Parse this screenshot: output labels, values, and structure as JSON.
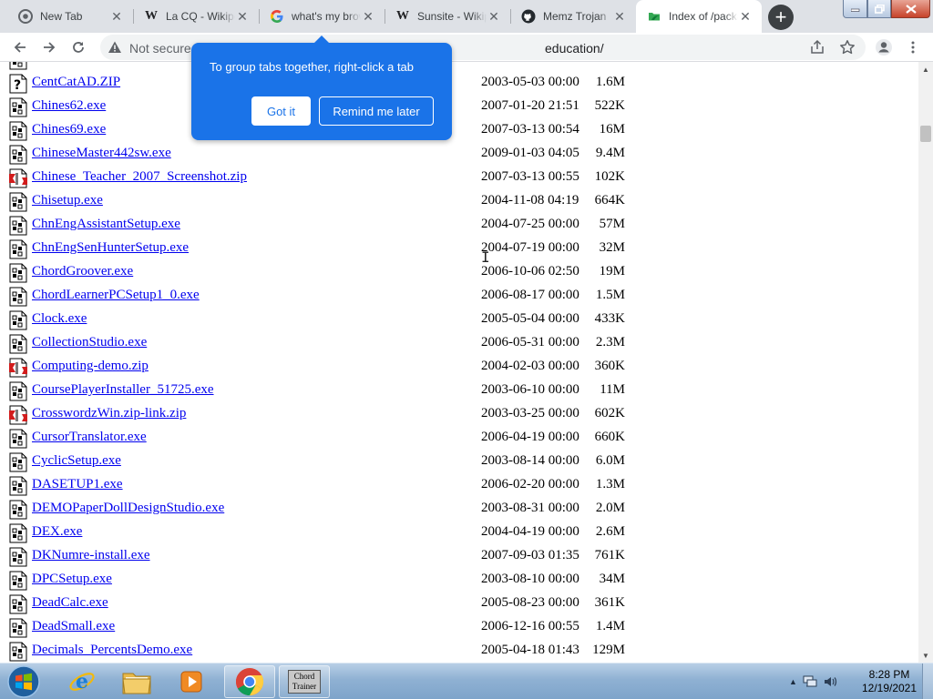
{
  "browser": {
    "tabs": [
      {
        "title": "New Tab",
        "icon": "chrome-icon",
        "active": false
      },
      {
        "title": "La CQ - Wikipedia",
        "icon": "wikipedia-icon",
        "active": false
      },
      {
        "title": "what's my browser",
        "icon": "google-icon",
        "active": false
      },
      {
        "title": "Sunsite - Wikipedia",
        "icon": "wikipedia-icon",
        "active": false
      },
      {
        "title": "Memz Trojan",
        "icon": "github-icon",
        "active": false
      },
      {
        "title": "Index of /packages/education/",
        "icon": "folder-leaf-icon",
        "active": true
      }
    ],
    "new_tab_label": "+",
    "address_bar": {
      "security_label": "Not secure",
      "url_visible_tail": "education/"
    }
  },
  "tab_group_bubble": {
    "message": "To group tabs together, right-click a tab",
    "got_it_label": "Got it",
    "remind_label": "Remind me later"
  },
  "listing": [
    {
      "name": "",
      "date": "",
      "size": "",
      "type": "exe"
    },
    {
      "name": "CentCatAD.ZIP",
      "date": "2003-05-03 00:00",
      "size": "1.6M",
      "type": "unknown"
    },
    {
      "name": "Chines62.exe",
      "date": "2007-01-20 21:51",
      "size": "522K",
      "type": "exe"
    },
    {
      "name": "Chines69.exe",
      "date": "2007-03-13 00:54",
      "size": "16M",
      "type": "exe"
    },
    {
      "name": "ChineseMaster442sw.exe",
      "date": "2009-01-03 04:05",
      "size": "9.4M",
      "type": "exe"
    },
    {
      "name": "Chinese_Teacher_2007_Screenshot.zip",
      "date": "2007-03-13 00:55",
      "size": "102K",
      "type": "zip"
    },
    {
      "name": "Chisetup.exe",
      "date": "2004-11-08 04:19",
      "size": "664K",
      "type": "exe"
    },
    {
      "name": "ChnEngAssistantSetup.exe",
      "date": "2004-07-25 00:00",
      "size": "57M",
      "type": "exe"
    },
    {
      "name": "ChnEngSenHunterSetup.exe",
      "date": "2004-07-19 00:00",
      "size": "32M",
      "type": "exe"
    },
    {
      "name": "ChordGroover.exe",
      "date": "2006-10-06 02:50",
      "size": "19M",
      "type": "exe"
    },
    {
      "name": "ChordLearnerPCSetup1_0.exe",
      "date": "2006-08-17 00:00",
      "size": "1.5M",
      "type": "exe"
    },
    {
      "name": "Clock.exe",
      "date": "2005-05-04 00:00",
      "size": "433K",
      "type": "exe"
    },
    {
      "name": "CollectionStudio.exe",
      "date": "2006-05-31 00:00",
      "size": "2.3M",
      "type": "exe"
    },
    {
      "name": "Computing-demo.zip",
      "date": "2004-02-03 00:00",
      "size": "360K",
      "type": "zip"
    },
    {
      "name": "CoursePlayerInstaller_51725.exe",
      "date": "2003-06-10 00:00",
      "size": "11M",
      "type": "exe"
    },
    {
      "name": "CrosswordzWin.zip-link.zip",
      "date": "2003-03-25 00:00",
      "size": "602K",
      "type": "zip"
    },
    {
      "name": "CursorTranslator.exe",
      "date": "2006-04-19 00:00",
      "size": "660K",
      "type": "exe"
    },
    {
      "name": "CyclicSetup.exe",
      "date": "2003-08-14 00:00",
      "size": "6.0M",
      "type": "exe"
    },
    {
      "name": "DASETUP1.exe",
      "date": "2006-02-20 00:00",
      "size": "1.3M",
      "type": "exe"
    },
    {
      "name": "DEMOPaperDollDesignStudio.exe",
      "date": "2003-08-31 00:00",
      "size": "2.0M",
      "type": "exe"
    },
    {
      "name": "DEX.exe",
      "date": "2004-04-19 00:00",
      "size": "2.6M",
      "type": "exe"
    },
    {
      "name": "DKNumre-install.exe",
      "date": "2007-09-03 01:35",
      "size": "761K",
      "type": "exe"
    },
    {
      "name": "DPCSetup.exe",
      "date": "2003-08-10 00:00",
      "size": "34M",
      "type": "exe"
    },
    {
      "name": "DeadCalc.exe",
      "date": "2005-08-23 00:00",
      "size": "361K",
      "type": "exe"
    },
    {
      "name": "DeadSmall.exe",
      "date": "2006-12-16 00:55",
      "size": "1.4M",
      "type": "exe"
    },
    {
      "name": "Decimals_PercentsDemo.exe",
      "date": "2005-04-18 01:43",
      "size": "129M",
      "type": "exe"
    }
  ],
  "taskbar": {
    "apps": [
      {
        "name": "internet-explorer",
        "icon": "internet-explorer-icon"
      },
      {
        "name": "windows-explorer",
        "icon": "folder-icon"
      },
      {
        "name": "media-player",
        "icon": "media-player-icon"
      },
      {
        "name": "chrome",
        "icon": "chrome-icon"
      },
      {
        "name": "chord-trainer",
        "icon": "chord-trainer-icon"
      }
    ],
    "chord_trainer_label": "Chord Trainer",
    "clock_time": "8:28 PM",
    "clock_date": "12/19/2021"
  },
  "colors": {
    "link": "#0000ee",
    "bubble": "#1a73e8",
    "tabstrip": "#dee1e6"
  }
}
